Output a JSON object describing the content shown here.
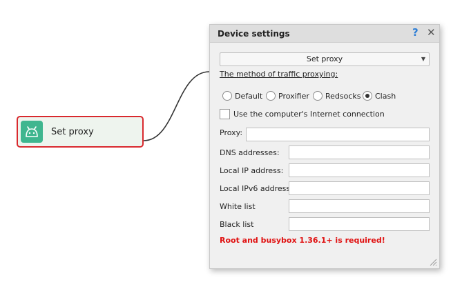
{
  "node": {
    "label": "Set proxy",
    "icon": "android-icon",
    "accent": "#3fb68f",
    "border_color": "#d9292e"
  },
  "dialog": {
    "title": "Device settings",
    "help_label": "?",
    "close_label": "✕",
    "action_select": {
      "selected": "Set proxy"
    },
    "method_label": "The method of traffic proxying:",
    "radios": [
      {
        "label": "Default",
        "checked": false
      },
      {
        "label": "Proxifier",
        "checked": false
      },
      {
        "label": "Redsocks",
        "checked": false
      },
      {
        "label": "Clash",
        "checked": true
      }
    ],
    "checkbox": {
      "label": "Use the computer's Internet connection",
      "checked": false
    },
    "fields": {
      "proxy": {
        "label": "Proxy:",
        "value": ""
      },
      "dns": {
        "label": "DNS addresses:",
        "value": ""
      },
      "local_ip": {
        "label": "Local IP address:",
        "value": ""
      },
      "local_ipv6": {
        "label": "Local IPv6 address:",
        "value": ""
      },
      "white_list": {
        "label": "White list",
        "value": ""
      },
      "black_list": {
        "label": "Black list",
        "value": ""
      }
    },
    "warning": "Root and busybox 1.36.1+ is required!",
    "warning_color": "#e01010"
  }
}
